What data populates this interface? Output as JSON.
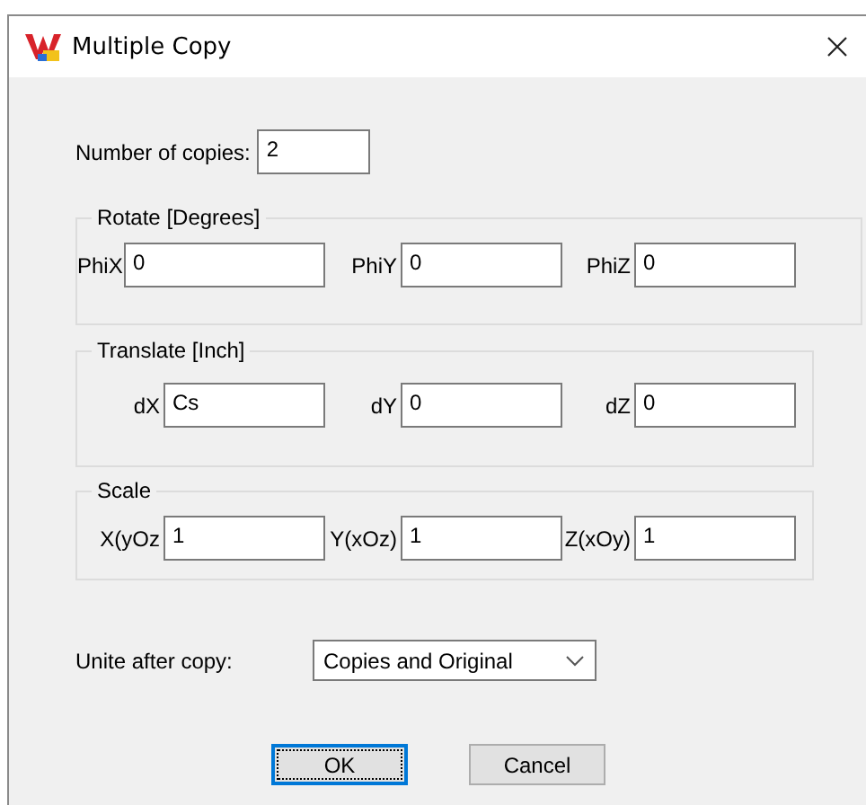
{
  "window": {
    "title": "Multiple Copy"
  },
  "copies": {
    "label": "Number of copies:",
    "value": "2"
  },
  "groups": [
    {
      "title": "Rotate [Degrees]",
      "fields": [
        {
          "label": "PhiX",
          "value": "0"
        },
        {
          "label": "PhiY",
          "value": "0"
        },
        {
          "label": "PhiZ",
          "value": "0"
        }
      ]
    },
    {
      "title": "Translate [Inch]",
      "fields": [
        {
          "label": "dX",
          "value": "Cs"
        },
        {
          "label": "dY",
          "value": "0"
        },
        {
          "label": "dZ",
          "value": "0"
        }
      ]
    },
    {
      "title": "Scale",
      "fields": [
        {
          "label": "X(yOz",
          "value": "1"
        },
        {
          "label": "Y(xOz)",
          "value": "1"
        },
        {
          "label": "Z(xOy)",
          "value": "1"
        }
      ]
    }
  ],
  "unite": {
    "label": "Unite after copy:",
    "value": "Copies and Original"
  },
  "buttons": [
    {
      "label": "OK",
      "focused": true
    },
    {
      "label": "Cancel",
      "focused": false
    }
  ]
}
